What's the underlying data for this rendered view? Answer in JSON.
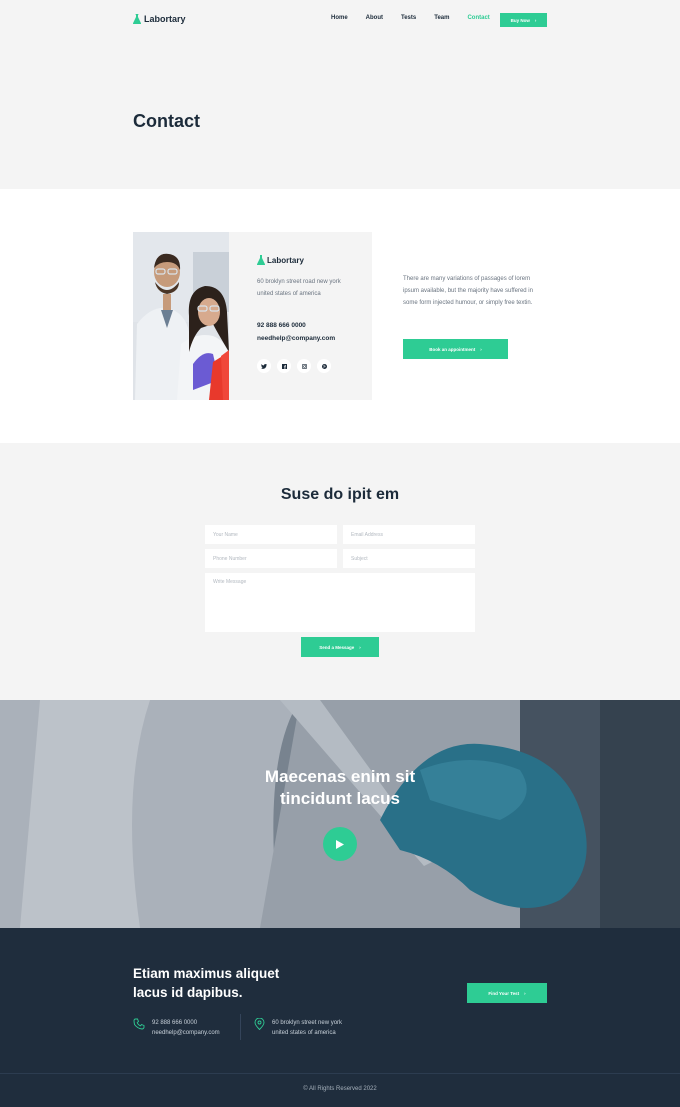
{
  "brand": {
    "name": "Labortary",
    "accent": "#2ecc94",
    "dark": "#1f2d3d"
  },
  "nav": {
    "items": [
      {
        "label": "Home",
        "active": false
      },
      {
        "label": "About",
        "active": false
      },
      {
        "label": "Tests",
        "active": false
      },
      {
        "label": "Team",
        "active": false
      },
      {
        "label": "Contact",
        "active": true
      }
    ],
    "buy_label": "Buy Now"
  },
  "page_title": "Contact",
  "contact_card": {
    "logo": "Labortary",
    "address": "60 broklyn street road new york united states of america",
    "phone": "92 888 666 0000",
    "email": "needhelp@company.com",
    "socials": [
      "twitter-icon",
      "facebook-icon",
      "instagram-icon",
      "pinterest-icon"
    ]
  },
  "intro": {
    "text": "There are many variations of passages of lorem ipsum available, but the majority have suffered in some form injected humour, or simply free textin.",
    "button": "Book an appointment"
  },
  "form": {
    "title": "Suse do ipit em",
    "name_placeholder": "Your Name",
    "email_placeholder": "Email Address",
    "phone_placeholder": "Phone Number",
    "subject_placeholder": "Subject",
    "message_placeholder": "Write Message",
    "submit": "Send a Message"
  },
  "video": {
    "title_line1": "Maecenas enim sit",
    "title_line2": "tincidunt lacus"
  },
  "cta": {
    "title_line1": "Etiam maximus aliquet",
    "title_line2": "lacus id dapibus.",
    "button": "Find Your Test",
    "phone": "92 888 666 0000",
    "email": "needhelp@company.com",
    "address_line1": "60 broklyn street new york",
    "address_line2": "united states of america"
  },
  "footer": {
    "copyright": "© All Rights Reserved 2022"
  }
}
